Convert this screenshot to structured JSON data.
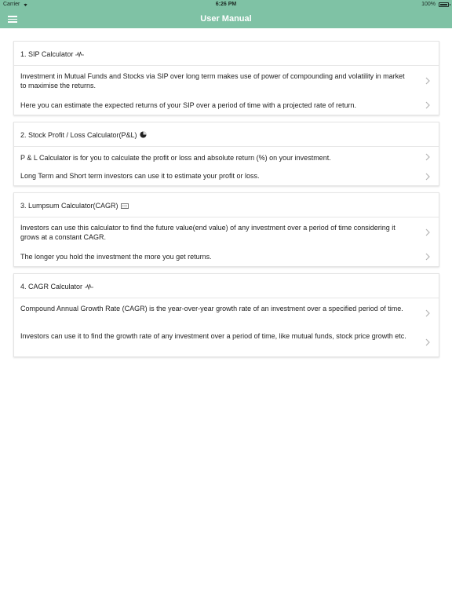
{
  "status_bar": {
    "carrier": "Carrier",
    "time": "6:26 PM",
    "battery": "100%"
  },
  "nav": {
    "title": "User Manual",
    "menu_icon": "hamburger-menu-icon"
  },
  "colors": {
    "accent": "#7fc2a5",
    "chevron": "#b5b5b5"
  },
  "sections": [
    {
      "title": "1. SIP Calculator",
      "icon": "pulse-icon",
      "rows": [
        "Investment in Mutual Funds and Stocks via SIP over long term makes use of power of compounding and volatility in market to maximise the returns.",
        "Here you can estimate the expected returns of your SIP over a period of time with a projected rate of return."
      ]
    },
    {
      "title": "2. Stock Profit / Loss Calculator(P&L)",
      "icon": "pie-ball-icon",
      "rows": [
        "P & L Calculator is for you to calculate the profit or loss and absolute return (%) on your investment.",
        "Long Term and Short term investors can use it to estimate your profit or loss."
      ]
    },
    {
      "title": "3. Lumpsum Calculator(CAGR)",
      "icon": "keyboard-icon",
      "rows": [
        "Investors can use this calculator to find the future value(end value) of any investment over a period of time considering it grows at a constant CAGR.",
        "The longer you hold the investment the more you get returns."
      ]
    },
    {
      "title": "4. CAGR Calculator",
      "icon": "pulse-icon",
      "rows": [
        "Compound Annual Growth Rate (CAGR) is the year-over-year growth rate of an investment over a specified period of time.",
        "Investors can use it to find the growth rate of any investment over a period of time, like mutual funds, stock price growth etc."
      ]
    }
  ]
}
